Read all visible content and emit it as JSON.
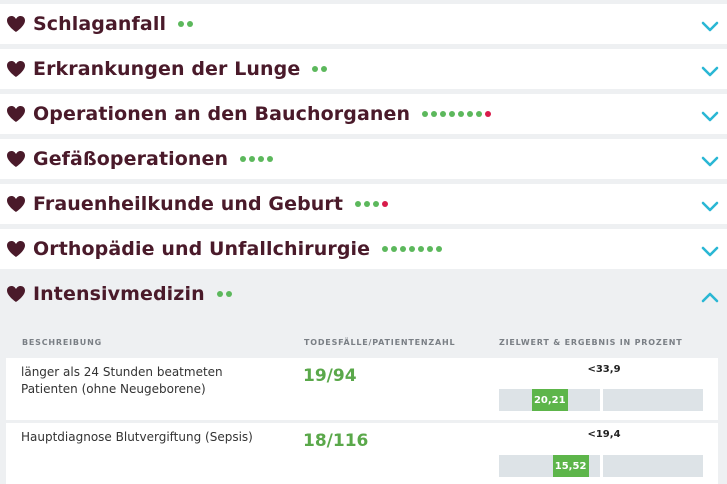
{
  "colors": {
    "heart": "#4a1a2a",
    "title": "#4a1a2a",
    "dot_green": "#5cb85c",
    "dot_red": "#d81b4a",
    "chevron": "#2ab7d4",
    "value_green": "#5aa84a",
    "bar_fill": "#5db54a",
    "bar_track": "#dde3e7"
  },
  "sections": [
    {
      "title": "Schlaganfall",
      "dots": [
        "green",
        "green"
      ],
      "expanded": false
    },
    {
      "title": "Erkrankungen der Lunge",
      "dots": [
        "green",
        "green"
      ],
      "expanded": false
    },
    {
      "title": "Operationen an den Bauchorganen",
      "dots": [
        "green",
        "green",
        "green",
        "green",
        "green",
        "green",
        "green",
        "red"
      ],
      "expanded": false
    },
    {
      "title": "Gefäßoperationen",
      "dots": [
        "green",
        "green",
        "green",
        "green"
      ],
      "expanded": false
    },
    {
      "title": "Frauenheilkunde und Geburt",
      "dots": [
        "green",
        "green",
        "green",
        "red"
      ],
      "expanded": false
    },
    {
      "title": "Orthopädie und Unfallchirurgie",
      "dots": [
        "green",
        "green",
        "green",
        "green",
        "green",
        "green",
        "green"
      ],
      "expanded": false
    },
    {
      "title": "Intensivmedizin",
      "dots": [
        "green",
        "green"
      ],
      "expanded": true
    }
  ],
  "table": {
    "columns": [
      "BESCHREIBUNG",
      "TODESFÄLLE/PATIENTENZAHL",
      "ZIELWERT & ERGEBNIS IN PROZENT"
    ],
    "rows": [
      {
        "description": "länger als 24 Stunden beatmeten Patienten (ohne Neugeborene)",
        "ratio": "19/94",
        "target": "<33,9",
        "result": "20,21",
        "target_value": 33.9,
        "result_value": 20.21
      },
      {
        "description": "Hauptdiagnose Blutvergiftung (Sepsis)",
        "ratio": "18/116",
        "target": "<19,4",
        "result": "15,52",
        "target_value": 19.4,
        "result_value": 15.52
      }
    ]
  },
  "icons": {
    "section": "heart-icon",
    "collapsed": "chevron-down-icon",
    "expanded": "chevron-up-icon"
  }
}
